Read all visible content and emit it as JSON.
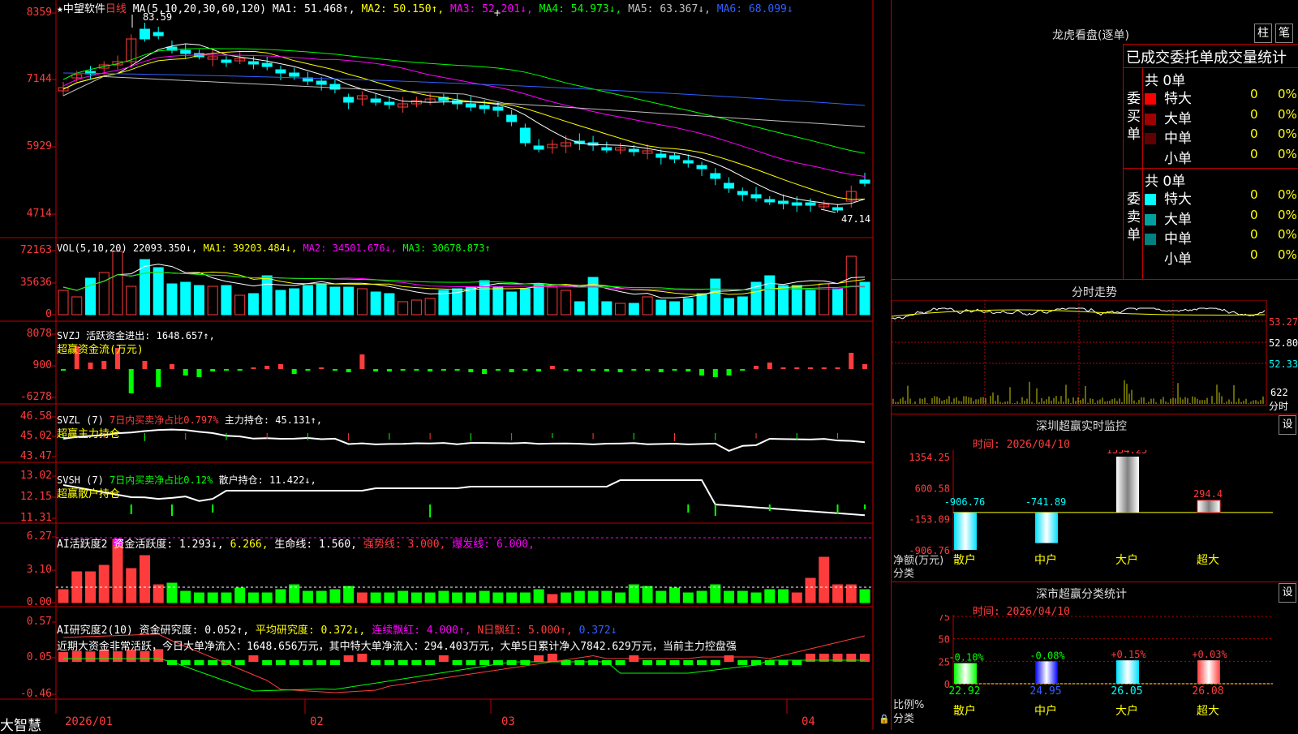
{
  "header": {
    "star": "★",
    "stock_name": "中望软件",
    "period": "日线",
    "ma_prefix": "MA(5,10,20,30,60,120)",
    "ma": [
      {
        "label": "MA1: 51.468↑,",
        "color": "#ffffff"
      },
      {
        "label": "MA2: 50.150↑,",
        "color": "#ffff00"
      },
      {
        "label": "MA3: 52.201↓,",
        "color": "#ff00ff"
      },
      {
        "label": "MA4: 54.973↓,",
        "color": "#00ff00"
      },
      {
        "label": "MA5: 63.367↓,",
        "color": "#c0c0c0"
      },
      {
        "label": "MA6: 68.099↓",
        "color": "#3060ff"
      }
    ]
  },
  "main_axis": [
    "8359",
    "7144",
    "5929",
    "4714"
  ],
  "main_marks": {
    "high": "83.59",
    "low": "47.14"
  },
  "vol": {
    "label": "VOL(5,10,20)",
    "value": "22093.350↓,",
    "ma1": "MA1: 39203.484↓,",
    "ma2": "MA2: 34501.676↓,",
    "ma3": "MA3: 30678.873↑",
    "axis": [
      "72163",
      "35636",
      "0"
    ]
  },
  "svzj": {
    "label": "SVZJ",
    "title": "活跃资金进出: 1648.657↑,",
    "sub": "超赢资金流(万元)",
    "axis": [
      "8078",
      "900",
      "-6278"
    ]
  },
  "svzl": {
    "label": "SVZL (7)",
    "ratio": "7日内买卖净占比0.797%",
    "hold": "主力持仓: 45.131↑,",
    "sub": "超赢主力持仓",
    "axis": [
      "46.58",
      "45.02",
      "43.47"
    ]
  },
  "svsh": {
    "label": "SVSH (7)",
    "ratio": "7日内买卖净占比0.12%",
    "hold": "散户持仓: 11.422↓,",
    "sub": "超赢散户持仓",
    "axis": [
      "13.02",
      "12.15",
      "11.31"
    ]
  },
  "ai1": {
    "label": "AI活跃度2",
    "a": "资金活跃度: 1.293↓,",
    "b": "6.266,",
    "c": "生命线: 1.560,",
    "d": "强势线: 3.000,",
    "e": "爆发线: 6.000,",
    "axis": [
      "6.27",
      "3.10",
      "0.00"
    ]
  },
  "ai2": {
    "label": "AI研究度2(10)",
    "a": "资金研究度: 0.052↑,",
    "b": "平均研究度: 0.372↓,",
    "c": "连续飘红: 4.000↑,",
    "d": "N日飘红: 5.000↑,",
    "e": "0.372↓",
    "note": "近期大资金非常活跃，今日大单净流入：1648.656万元，其中特大单净流入：294.403万元，大单5日累计净入7842.629万元，当前主力控盘强",
    "axis": [
      "0.57",
      "0.05",
      "-0.46"
    ]
  },
  "dates": [
    "2026/01",
    "02",
    "03",
    "04"
  ],
  "brand": "大智慧",
  "right": {
    "lhkp_title": "龙虎看盘(逐单)",
    "btn_zhu": "柱",
    "btn_bi": "笔",
    "ob_title": "已成交委托单成交量统计",
    "buy_label": "委买单",
    "sell_label": "委卖单",
    "buy_total": "共 0单",
    "sell_total": "共 0单",
    "buy_rows": [
      {
        "name": "特大",
        "num": "0",
        "pct": "0%",
        "color": "#ff0000"
      },
      {
        "name": "大单",
        "num": "0",
        "pct": "0%",
        "color": "#a00000"
      },
      {
        "name": "中单",
        "num": "0",
        "pct": "0%",
        "color": "#600000"
      },
      {
        "name": "小单",
        "num": "0",
        "pct": "0%",
        "color": ""
      }
    ],
    "sell_rows": [
      {
        "name": "特大",
        "num": "0",
        "pct": "0%",
        "color": "#00ffff"
      },
      {
        "name": "大单",
        "num": "0",
        "pct": "0%",
        "color": "#00a0a0"
      },
      {
        "name": "中单",
        "num": "0",
        "pct": "0%",
        "color": "#008080"
      },
      {
        "name": "小单",
        "num": "0",
        "pct": "0%",
        "color": ""
      }
    ],
    "fenshi_title": "分时走势",
    "fenshi_axis": [
      "53.27",
      "52.80",
      "52.33",
      "622",
      "分时"
    ],
    "sz_title": "深圳超赢实时监控",
    "btn_set": "设",
    "sz_time": "时间: 2026/04/10",
    "sz_axis": [
      "1354.25",
      "600.58",
      "-153.09",
      "-906.76"
    ],
    "sz_axis_lbl1": "净额(万元)",
    "sz_axis_lbl2": "分类",
    "sz_cats": [
      "散户",
      "中户",
      "大户",
      "超大"
    ],
    "sz_vals": [
      -906.76,
      -741.89,
      1354.25,
      294.4
    ],
    "sz_val_lbls": [
      "-906.76",
      "-741.89",
      "1354.25",
      "294.4"
    ],
    "fl_title": "深市超赢分类统计",
    "fl_time": "时间: 2026/04/10",
    "fl_axis": [
      "75",
      "50",
      "25",
      "0"
    ],
    "fl_axis_lbl1": "比例%",
    "fl_axis_lbl2": "分类",
    "fl_cats": [
      "散户",
      "中户",
      "大户",
      "超大"
    ],
    "fl_vals": [
      22.92,
      24.95,
      26.05,
      26.08
    ],
    "fl_val_lbls": [
      "22.92",
      "24.95",
      "26.05",
      "26.08"
    ],
    "fl_chg": [
      "-0.10%",
      "-0.08%",
      "+0.15%",
      "+0.03%"
    ]
  },
  "colors": {
    "up": "#ff3c3c",
    "down": "#00ffff",
    "grid": "#c00000",
    "green": "#00ff00",
    "yellow": "#ffff00"
  }
}
